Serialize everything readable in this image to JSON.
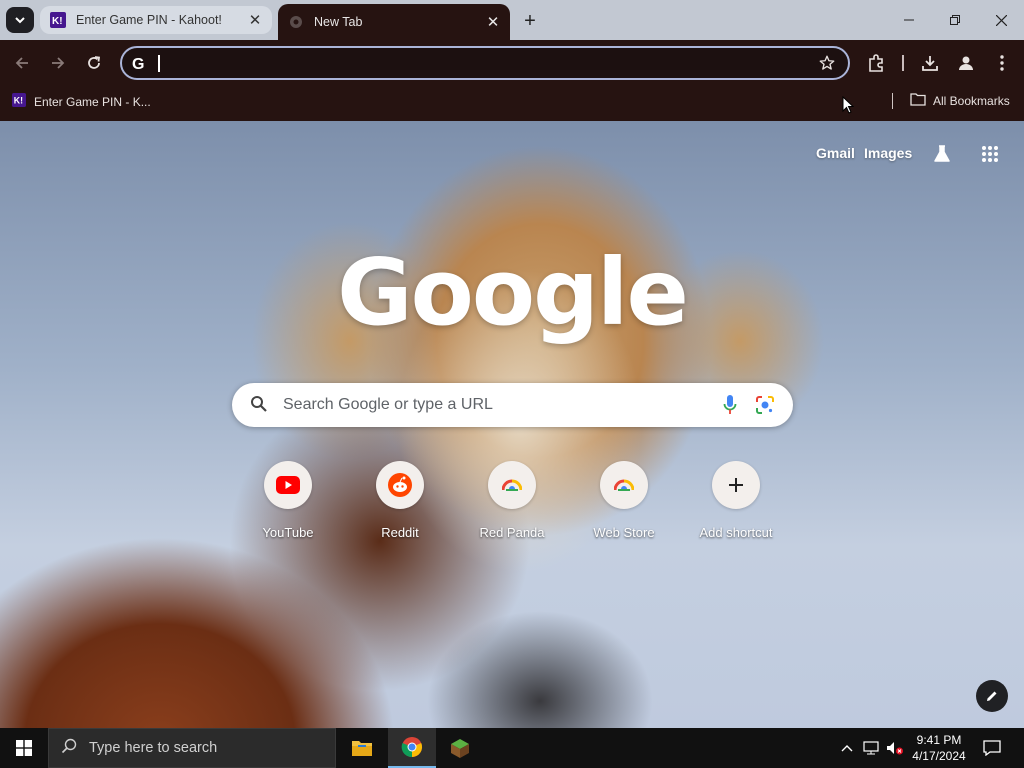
{
  "browser": {
    "tabs": [
      {
        "title": "Enter Game PIN - Kahoot!",
        "favicon": "kahoot-icon",
        "active": false
      },
      {
        "title": "New Tab",
        "favicon": "chrome-newtab-icon",
        "active": true
      }
    ],
    "omnibox": {
      "value": "",
      "placeholder": ""
    },
    "bookmarks": [
      {
        "label": "Enter Game PIN - K...",
        "favicon": "kahoot-icon"
      }
    ],
    "all_bookmarks_label": "All Bookmarks"
  },
  "ntp": {
    "links": {
      "gmail": "Gmail",
      "images": "Images"
    },
    "logo_text": "Google",
    "search_placeholder": "Search Google or type a URL",
    "shortcuts": [
      {
        "label": "YouTube",
        "icon": "youtube-icon"
      },
      {
        "label": "Reddit",
        "icon": "reddit-icon"
      },
      {
        "label": "Red Panda",
        "icon": "chrome-web-icon"
      },
      {
        "label": "Web Store",
        "icon": "chrome-web-icon"
      },
      {
        "label": "Add shortcut",
        "icon": "plus-icon"
      }
    ]
  },
  "taskbar": {
    "search_placeholder": "Type here to search",
    "time": "9:41 PM",
    "date": "4/17/2024"
  },
  "colors": {
    "chrome_frame": "#261311",
    "tabstrip": "#c2c8d2",
    "taskbar": "#111111"
  }
}
